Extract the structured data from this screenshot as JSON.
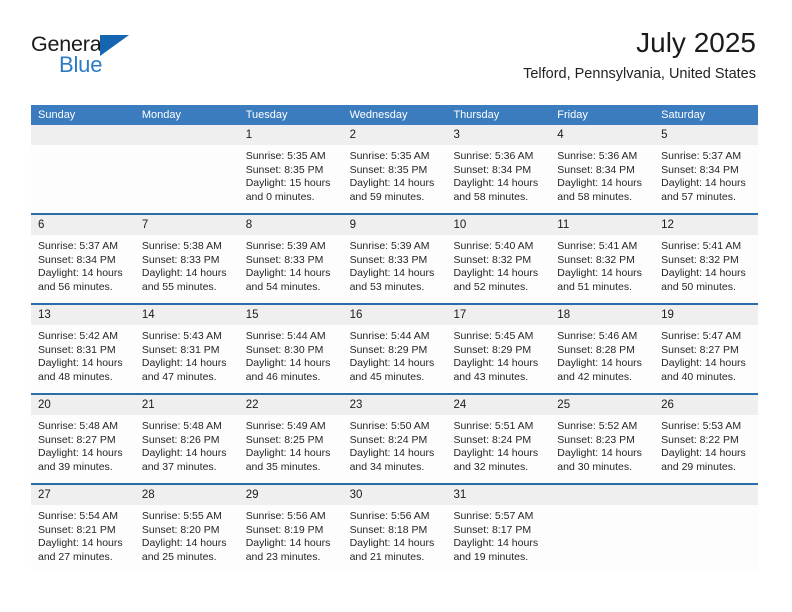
{
  "logo": {
    "word_general": "General",
    "word_blue": "Blue",
    "triangle_color": "#1565b0",
    "blue_color": "#2b7cc4"
  },
  "header": {
    "title": "July 2025",
    "subtitle": "Telford, Pennsylvania, United States"
  },
  "theme": {
    "header_blue": "#3a7cbe",
    "row_divider_blue": "#2b6da9",
    "day_band_gray": "#efefef"
  },
  "weekdays": [
    "Sunday",
    "Monday",
    "Tuesday",
    "Wednesday",
    "Thursday",
    "Friday",
    "Saturday"
  ],
  "labels": {
    "sunrise_prefix": "Sunrise:",
    "sunset_prefix": "Sunset:",
    "daylight_prefix": "Daylight:"
  },
  "weeks": [
    [
      {
        "day": "",
        "empty": true
      },
      {
        "day": "",
        "empty": true
      },
      {
        "day": "1",
        "sunrise": "Sunrise: 5:35 AM",
        "sunset": "Sunset: 8:35 PM",
        "daylight1": "Daylight: 15 hours",
        "daylight2": "and 0 minutes."
      },
      {
        "day": "2",
        "sunrise": "Sunrise: 5:35 AM",
        "sunset": "Sunset: 8:35 PM",
        "daylight1": "Daylight: 14 hours",
        "daylight2": "and 59 minutes."
      },
      {
        "day": "3",
        "sunrise": "Sunrise: 5:36 AM",
        "sunset": "Sunset: 8:34 PM",
        "daylight1": "Daylight: 14 hours",
        "daylight2": "and 58 minutes."
      },
      {
        "day": "4",
        "sunrise": "Sunrise: 5:36 AM",
        "sunset": "Sunset: 8:34 PM",
        "daylight1": "Daylight: 14 hours",
        "daylight2": "and 58 minutes."
      },
      {
        "day": "5",
        "sunrise": "Sunrise: 5:37 AM",
        "sunset": "Sunset: 8:34 PM",
        "daylight1": "Daylight: 14 hours",
        "daylight2": "and 57 minutes."
      }
    ],
    [
      {
        "day": "6",
        "sunrise": "Sunrise: 5:37 AM",
        "sunset": "Sunset: 8:34 PM",
        "daylight1": "Daylight: 14 hours",
        "daylight2": "and 56 minutes."
      },
      {
        "day": "7",
        "sunrise": "Sunrise: 5:38 AM",
        "sunset": "Sunset: 8:33 PM",
        "daylight1": "Daylight: 14 hours",
        "daylight2": "and 55 minutes."
      },
      {
        "day": "8",
        "sunrise": "Sunrise: 5:39 AM",
        "sunset": "Sunset: 8:33 PM",
        "daylight1": "Daylight: 14 hours",
        "daylight2": "and 54 minutes."
      },
      {
        "day": "9",
        "sunrise": "Sunrise: 5:39 AM",
        "sunset": "Sunset: 8:33 PM",
        "daylight1": "Daylight: 14 hours",
        "daylight2": "and 53 minutes."
      },
      {
        "day": "10",
        "sunrise": "Sunrise: 5:40 AM",
        "sunset": "Sunset: 8:32 PM",
        "daylight1": "Daylight: 14 hours",
        "daylight2": "and 52 minutes."
      },
      {
        "day": "11",
        "sunrise": "Sunrise: 5:41 AM",
        "sunset": "Sunset: 8:32 PM",
        "daylight1": "Daylight: 14 hours",
        "daylight2": "and 51 minutes."
      },
      {
        "day": "12",
        "sunrise": "Sunrise: 5:41 AM",
        "sunset": "Sunset: 8:32 PM",
        "daylight1": "Daylight: 14 hours",
        "daylight2": "and 50 minutes."
      }
    ],
    [
      {
        "day": "13",
        "sunrise": "Sunrise: 5:42 AM",
        "sunset": "Sunset: 8:31 PM",
        "daylight1": "Daylight: 14 hours",
        "daylight2": "and 48 minutes."
      },
      {
        "day": "14",
        "sunrise": "Sunrise: 5:43 AM",
        "sunset": "Sunset: 8:31 PM",
        "daylight1": "Daylight: 14 hours",
        "daylight2": "and 47 minutes."
      },
      {
        "day": "15",
        "sunrise": "Sunrise: 5:44 AM",
        "sunset": "Sunset: 8:30 PM",
        "daylight1": "Daylight: 14 hours",
        "daylight2": "and 46 minutes."
      },
      {
        "day": "16",
        "sunrise": "Sunrise: 5:44 AM",
        "sunset": "Sunset: 8:29 PM",
        "daylight1": "Daylight: 14 hours",
        "daylight2": "and 45 minutes."
      },
      {
        "day": "17",
        "sunrise": "Sunrise: 5:45 AM",
        "sunset": "Sunset: 8:29 PM",
        "daylight1": "Daylight: 14 hours",
        "daylight2": "and 43 minutes."
      },
      {
        "day": "18",
        "sunrise": "Sunrise: 5:46 AM",
        "sunset": "Sunset: 8:28 PM",
        "daylight1": "Daylight: 14 hours",
        "daylight2": "and 42 minutes."
      },
      {
        "day": "19",
        "sunrise": "Sunrise: 5:47 AM",
        "sunset": "Sunset: 8:27 PM",
        "daylight1": "Daylight: 14 hours",
        "daylight2": "and 40 minutes."
      }
    ],
    [
      {
        "day": "20",
        "sunrise": "Sunrise: 5:48 AM",
        "sunset": "Sunset: 8:27 PM",
        "daylight1": "Daylight: 14 hours",
        "daylight2": "and 39 minutes."
      },
      {
        "day": "21",
        "sunrise": "Sunrise: 5:48 AM",
        "sunset": "Sunset: 8:26 PM",
        "daylight1": "Daylight: 14 hours",
        "daylight2": "and 37 minutes."
      },
      {
        "day": "22",
        "sunrise": "Sunrise: 5:49 AM",
        "sunset": "Sunset: 8:25 PM",
        "daylight1": "Daylight: 14 hours",
        "daylight2": "and 35 minutes."
      },
      {
        "day": "23",
        "sunrise": "Sunrise: 5:50 AM",
        "sunset": "Sunset: 8:24 PM",
        "daylight1": "Daylight: 14 hours",
        "daylight2": "and 34 minutes."
      },
      {
        "day": "24",
        "sunrise": "Sunrise: 5:51 AM",
        "sunset": "Sunset: 8:24 PM",
        "daylight1": "Daylight: 14 hours",
        "daylight2": "and 32 minutes."
      },
      {
        "day": "25",
        "sunrise": "Sunrise: 5:52 AM",
        "sunset": "Sunset: 8:23 PM",
        "daylight1": "Daylight: 14 hours",
        "daylight2": "and 30 minutes."
      },
      {
        "day": "26",
        "sunrise": "Sunrise: 5:53 AM",
        "sunset": "Sunset: 8:22 PM",
        "daylight1": "Daylight: 14 hours",
        "daylight2": "and 29 minutes."
      }
    ],
    [
      {
        "day": "27",
        "sunrise": "Sunrise: 5:54 AM",
        "sunset": "Sunset: 8:21 PM",
        "daylight1": "Daylight: 14 hours",
        "daylight2": "and 27 minutes."
      },
      {
        "day": "28",
        "sunrise": "Sunrise: 5:55 AM",
        "sunset": "Sunset: 8:20 PM",
        "daylight1": "Daylight: 14 hours",
        "daylight2": "and 25 minutes."
      },
      {
        "day": "29",
        "sunrise": "Sunrise: 5:56 AM",
        "sunset": "Sunset: 8:19 PM",
        "daylight1": "Daylight: 14 hours",
        "daylight2": "and 23 minutes."
      },
      {
        "day": "30",
        "sunrise": "Sunrise: 5:56 AM",
        "sunset": "Sunset: 8:18 PM",
        "daylight1": "Daylight: 14 hours",
        "daylight2": "and 21 minutes."
      },
      {
        "day": "31",
        "sunrise": "Sunrise: 5:57 AM",
        "sunset": "Sunset: 8:17 PM",
        "daylight1": "Daylight: 14 hours",
        "daylight2": "and 19 minutes."
      },
      {
        "day": "",
        "empty": true
      },
      {
        "day": "",
        "empty": true
      }
    ]
  ]
}
